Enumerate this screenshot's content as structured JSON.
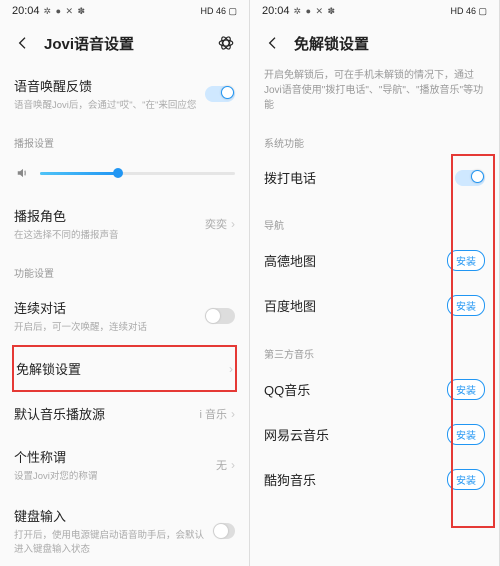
{
  "status": {
    "time": "20:04",
    "icons": "✲ ● ✕ ✽",
    "right": "HD 46 ▢"
  },
  "left": {
    "title": "Jovi语音设置",
    "wake": {
      "title": "语音唤醒反馈",
      "sub": "语音唤醒Jovi后，会通过\"哎\"、\"在\"来回应您"
    },
    "section_play": "播报设置",
    "role": {
      "title": "播报角色",
      "sub": "在这选择不同的播报声音",
      "value": "奕奕"
    },
    "section_func": "功能设置",
    "cont": {
      "title": "连续对话",
      "sub": "开启后，可一次唤醒，连续对话"
    },
    "unlock": {
      "title": "免解锁设置"
    },
    "music": {
      "title": "默认音乐播放源",
      "value": "i 音乐"
    },
    "nick": {
      "title": "个性称谓",
      "sub": "设置Jovi对您的称谓",
      "value": "无"
    },
    "kb": {
      "title": "键盘输入",
      "sub": "打开后，使用电源键启动语音助手后，会默认进入键盘输入状态"
    }
  },
  "right": {
    "title": "免解锁设置",
    "desc": "开启免解锁后，可在手机未解锁的情况下，通过Jovi语音使用\"拨打电话\"、\"导航\"、\"播放音乐\"等功能",
    "section_sys": "系统功能",
    "call": "拨打电话",
    "section_nav": "导航",
    "gaode": "高德地图",
    "baidu": "百度地图",
    "section_music": "第三方音乐",
    "qq": "QQ音乐",
    "netease": "网易云音乐",
    "kugou": "酷狗音乐",
    "install": "安装"
  }
}
